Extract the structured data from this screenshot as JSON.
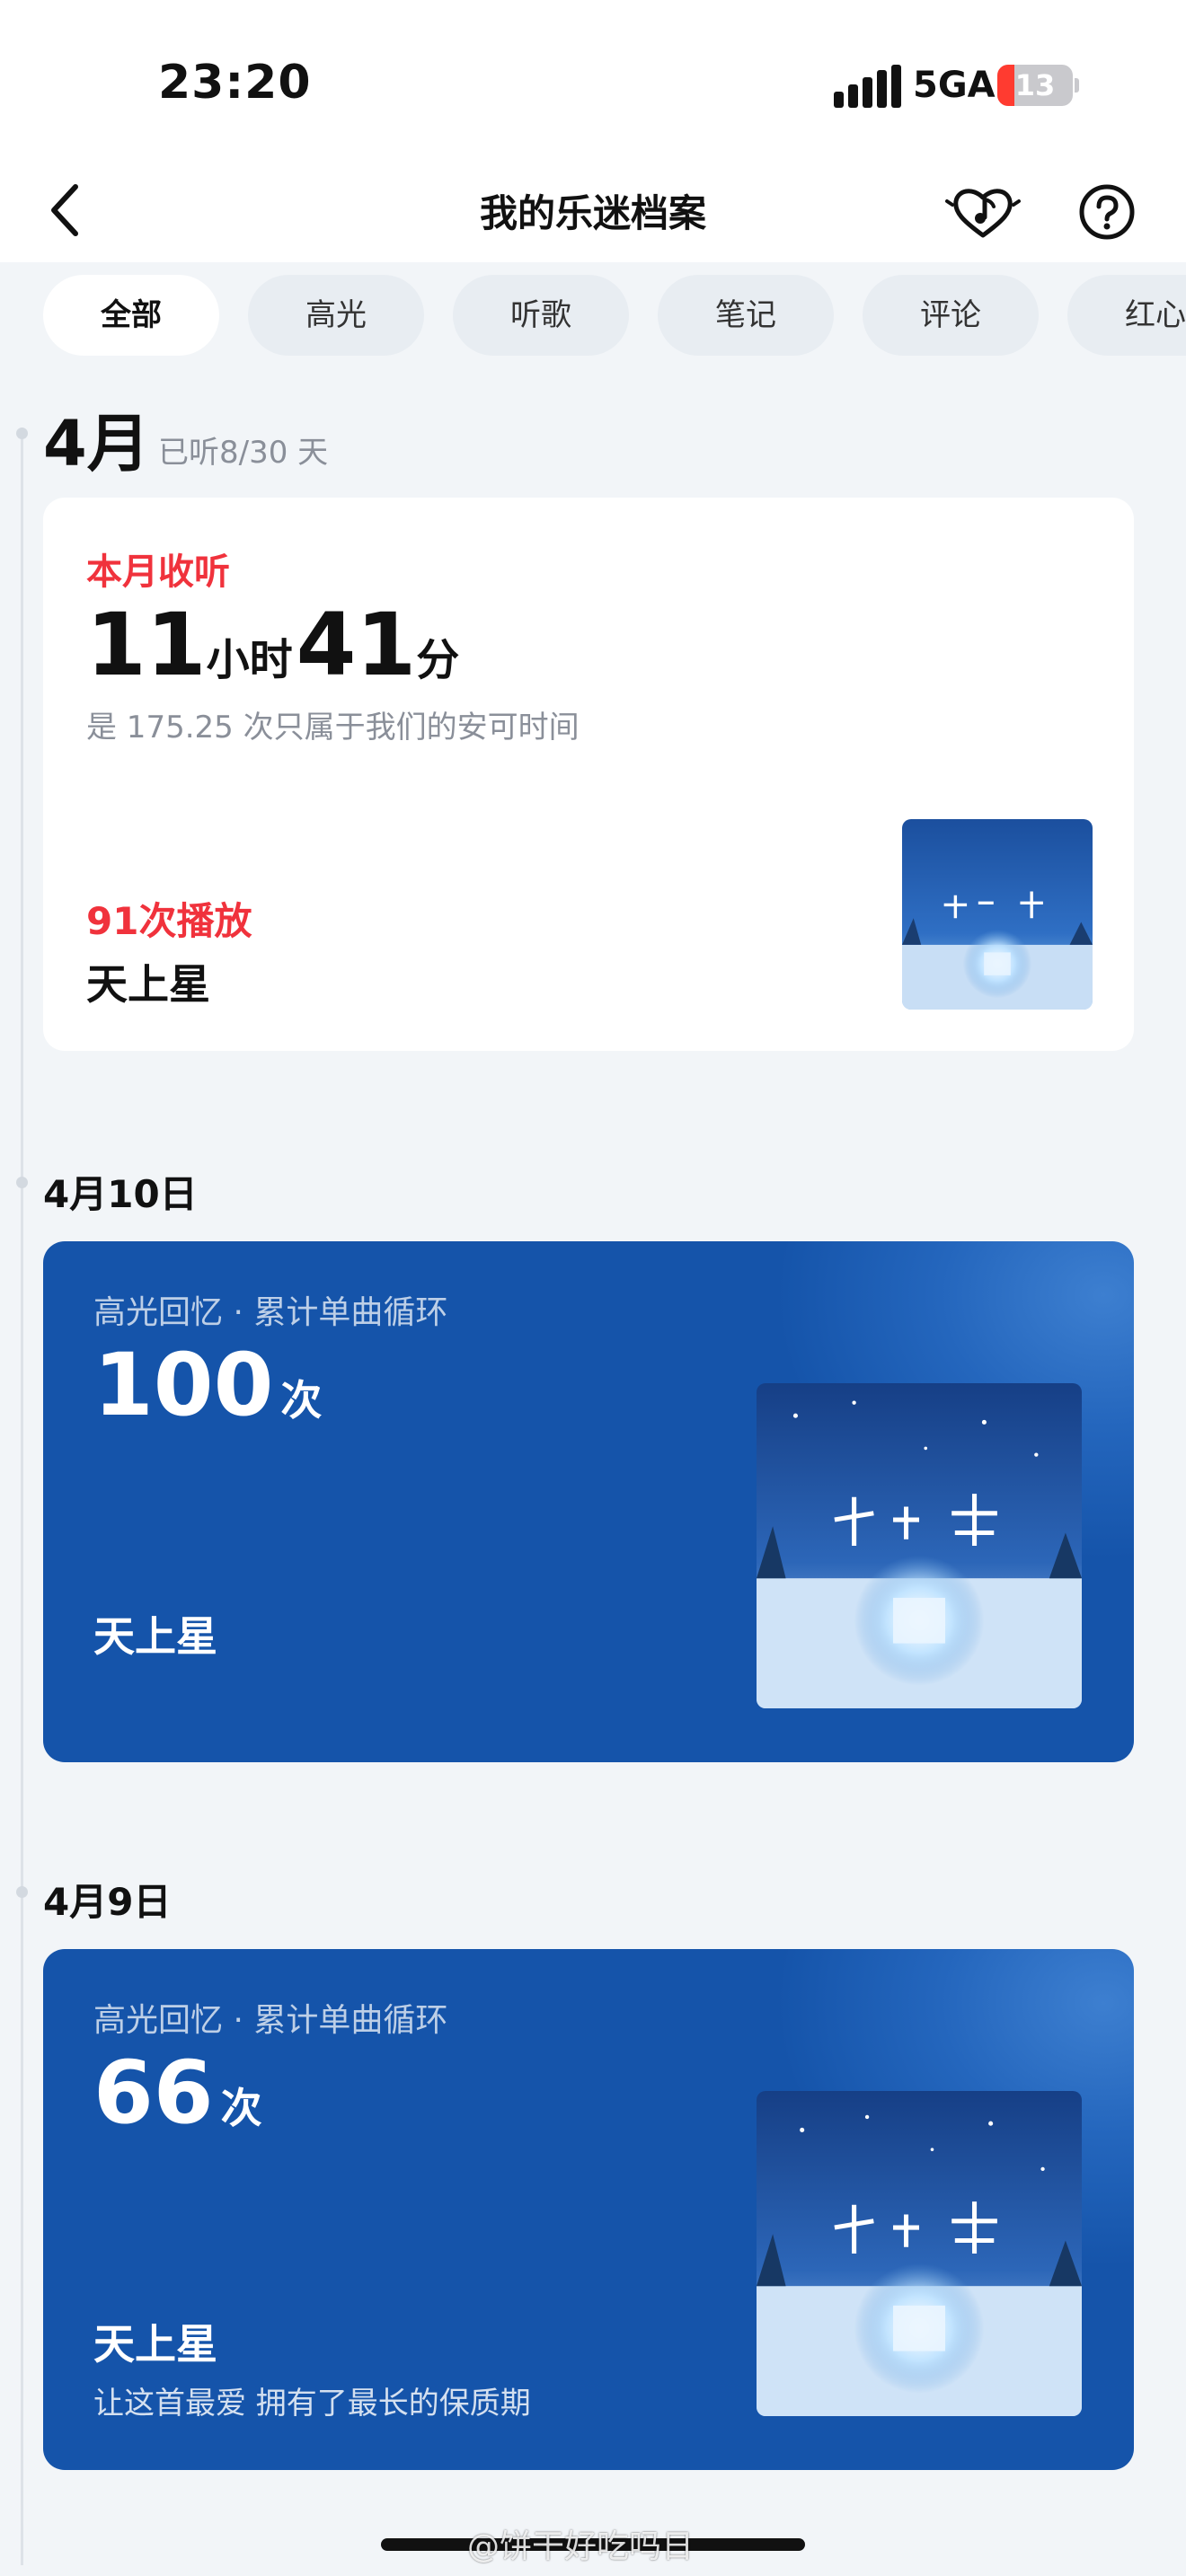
{
  "status_bar": {
    "time": "23:20",
    "network": "5GA",
    "battery": "13",
    "battery_level_percent": 13
  },
  "header": {
    "title": "我的乐迷档案",
    "icons": [
      "back-icon",
      "heart-music-icon",
      "help-icon"
    ]
  },
  "tabs": [
    {
      "label": "全部",
      "active": true
    },
    {
      "label": "高光",
      "active": false
    },
    {
      "label": "听歌",
      "active": false
    },
    {
      "label": "笔记",
      "active": false
    },
    {
      "label": "评论",
      "active": false
    },
    {
      "label": "红心",
      "active": false
    }
  ],
  "month_section": {
    "month": "4月",
    "listened_days": "已听8/30 天",
    "summary_card": {
      "label": "本月收听",
      "hours": "11",
      "hours_unit": "小时",
      "minutes": "41",
      "minutes_unit": "分",
      "subtitle": "是 175.25 次只属于我们的安可时间",
      "play_count": "91次播放",
      "song": "天上星"
    }
  },
  "entries": [
    {
      "date": "4月10日",
      "label": "高光回忆 · 累计单曲循环",
      "count": "100",
      "unit": "次",
      "song": "天上星",
      "tagline": ""
    },
    {
      "date": "4月9日",
      "label": "高光回忆 · 累计单曲循环",
      "count": "66",
      "unit": "次",
      "song": "天上星",
      "tagline": "让这首最爱 拥有了最长的保质期"
    }
  ],
  "watermark": "@饼干好吃吗日",
  "colors": {
    "accent_red": "#f0323c",
    "highlight_blue": "#1554aa",
    "page_bg": "#f2f5f8"
  }
}
